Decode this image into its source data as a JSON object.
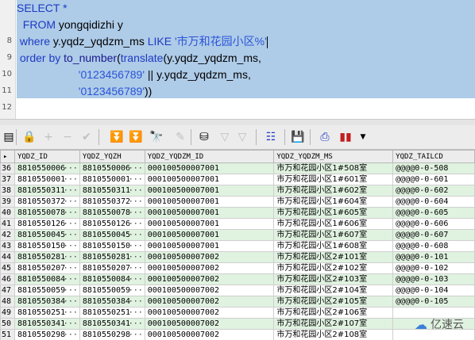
{
  "editor": {
    "line_numbers": [
      "",
      "",
      "8",
      "9",
      "10",
      "11",
      "12"
    ],
    "lines": {
      "l1": [
        {
          "t": "SELECT *",
          "c": "kw"
        }
      ],
      "l2": [
        {
          "t": "  FROM ",
          "c": "kw"
        },
        {
          "t": "yongqidizhi y",
          "c": "pl"
        }
      ],
      "l3": [
        {
          "t": " where ",
          "c": "kw"
        },
        {
          "t": "y.yqdz_yqdzm_ms ",
          "c": "pl"
        },
        {
          "t": "LIKE ",
          "c": "kw"
        },
        {
          "t": "'市万和花园小区%'",
          "c": "str"
        }
      ],
      "l4": [
        {
          "t": " order by ",
          "c": "kw"
        },
        {
          "t": "to_number",
          "c": "fn"
        },
        {
          "t": "(",
          "c": "pl"
        },
        {
          "t": "translate",
          "c": "kw"
        },
        {
          "t": "(y.yqdz_yqdzm_ms,",
          "c": "pl"
        }
      ],
      "l5": [
        {
          "t": "                    ",
          "c": "pl"
        },
        {
          "t": "'0123456789'",
          "c": "str"
        },
        {
          "t": " || y.yqdz_yqdzm_ms,",
          "c": "pl"
        }
      ],
      "l6": [
        {
          "t": "                    ",
          "c": "pl"
        },
        {
          "t": "'0123456789'",
          "c": "str"
        },
        {
          "t": "))",
          "c": "pl"
        }
      ]
    }
  },
  "grid": {
    "columns": [
      "YQDZ_ID",
      "YQDZ_YQZH",
      "YQDZ_YQDZM_ID",
      "YQDZ_YQDZM_MS",
      "YQDZ_TAILCD"
    ],
    "ellipsis": "···",
    "rows": [
      {
        "n": "36",
        "id": "8810550006",
        "yqzh": "8810550006",
        "dzm_id": "000100500007001",
        "ms": "市万和花园小区1#508室",
        "tail": "@@@@0-0-508"
      },
      {
        "n": "37",
        "id": "8810550001",
        "yqzh": "8810550001",
        "dzm_id": "000100500007001",
        "ms": "市万和花园小区1#601室",
        "tail": "@@@@0-0-601"
      },
      {
        "n": "38",
        "id": "8810550311",
        "yqzh": "8810550311",
        "dzm_id": "000100500007001",
        "ms": "市万和花园小区1#602室",
        "tail": "@@@@0-0-602"
      },
      {
        "n": "39",
        "id": "8810550372",
        "yqzh": "8810550372",
        "dzm_id": "000100500007001",
        "ms": "市万和花园小区1#604室",
        "tail": "@@@@0-0-604"
      },
      {
        "n": "40",
        "id": "8810550078",
        "yqzh": "8810550078",
        "dzm_id": "000100500007001",
        "ms": "市万和花园小区1#605室",
        "tail": "@@@@0-0-605"
      },
      {
        "n": "41",
        "id": "8810550126",
        "yqzh": "8810550126",
        "dzm_id": "000100500007001",
        "ms": "市万和花园小区1#606室",
        "tail": "@@@@0-0-606"
      },
      {
        "n": "42",
        "id": "8810550045",
        "yqzh": "8810550045",
        "dzm_id": "000100500007001",
        "ms": "市万和花园小区1#607室",
        "tail": "@@@@0-0-607"
      },
      {
        "n": "43",
        "id": "8810550150",
        "yqzh": "8810550150",
        "dzm_id": "000100500007001",
        "ms": "市万和花园小区1#608室",
        "tail": "@@@@0-0-608"
      },
      {
        "n": "44",
        "id": "8810550281",
        "yqzh": "8810550281",
        "dzm_id": "000100500007002",
        "ms": "市万和花园小区2#101室",
        "tail": "@@@@0-0-101"
      },
      {
        "n": "45",
        "id": "8810550207",
        "yqzh": "8810550207",
        "dzm_id": "000100500007002",
        "ms": "市万和花园小区2#102室",
        "tail": "@@@@0-0-102"
      },
      {
        "n": "46",
        "id": "8810550084",
        "yqzh": "8810550084",
        "dzm_id": "000100500007002",
        "ms": "市万和花园小区2#103室",
        "tail": "@@@@0-0-103"
      },
      {
        "n": "47",
        "id": "8810550059",
        "yqzh": "8810550059",
        "dzm_id": "000100500007002",
        "ms": "市万和花园小区2#104室",
        "tail": "@@@@0-0-104"
      },
      {
        "n": "48",
        "id": "8810550384",
        "yqzh": "8810550384",
        "dzm_id": "000100500007002",
        "ms": "市万和花园小区2#105室",
        "tail": "@@@@0-0-105"
      },
      {
        "n": "49",
        "id": "8810550251",
        "yqzh": "8810550251",
        "dzm_id": "000100500007002",
        "ms": "市万和花园小区2#106室",
        "tail": ""
      },
      {
        "n": "50",
        "id": "8810550341",
        "yqzh": "8810550341",
        "dzm_id": "000100500007002",
        "ms": "市万和花园小区2#107室",
        "tail": ""
      },
      {
        "n": "51",
        "id": "8810550298",
        "yqzh": "8810550298",
        "dzm_id": "000100500007002",
        "ms": "市万和花园小区2#108室",
        "tail": ""
      }
    ]
  },
  "toolbar": {
    "icons": [
      "grid-menu-icon",
      "lock-icon",
      "add-record-icon",
      "delete-record-icon",
      "post-changes-icon",
      "next-page-icon",
      "last-page-icon",
      "find-icon",
      "clear-icon",
      "export-icon",
      "prev-arrow-icon",
      "next-arrow-icon",
      "query-plan-icon",
      "save-icon",
      "print-icon",
      "chart-icon"
    ]
  },
  "watermark": {
    "text": "亿速云"
  },
  "colors": {
    "selection": "#aecbe8",
    "keyword": "#1d3bc2",
    "string": "#2a55d8",
    "row_alt": "#e0f2e0"
  }
}
